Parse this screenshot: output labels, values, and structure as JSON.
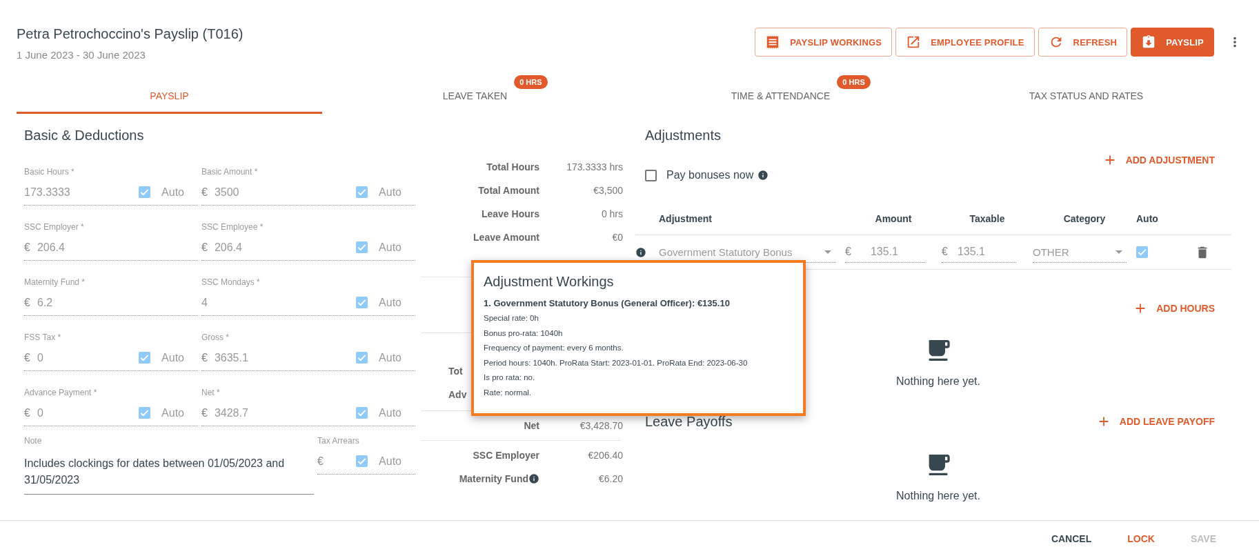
{
  "header": {
    "title": "Petra Petrochoccino's Payslip (T016)",
    "period": "1 June 2023 - 30 June 2023",
    "actions": [
      {
        "label": "PAYSLIP WORKINGS",
        "kind": "outlined"
      },
      {
        "label": "EMPLOYEE PROFILE",
        "kind": "outlined"
      },
      {
        "label": "REFRESH",
        "kind": "outlined"
      },
      {
        "label": "PAYSLIP",
        "kind": "filled"
      }
    ]
  },
  "tabs": [
    {
      "label": "PAYSLIP",
      "selected": true
    },
    {
      "label": "LEAVE TAKEN",
      "selected": false,
      "badge": "0 HRS"
    },
    {
      "label": "TIME & ATTENDANCE",
      "selected": false,
      "badge": "0 HRS"
    },
    {
      "label": "TAX STATUS AND RATES",
      "selected": false
    }
  ],
  "basic": {
    "title": "Basic & Deductions",
    "fields": [
      {
        "label": "Basic Hours *",
        "value": "173.3333",
        "kind": "auto",
        "checked": true,
        "auto_label": "Auto"
      },
      {
        "label": "Basic Amount *",
        "prefix": "€",
        "value": "3500",
        "kind": "auto",
        "checked": true,
        "auto_label": "Auto"
      },
      {
        "label": "SSC Employer *",
        "prefix": "€",
        "value": "206.4",
        "kind": "plain"
      },
      {
        "label": "SSC Employee *",
        "prefix": "€",
        "value": "206.4",
        "kind": "auto",
        "checked": true,
        "auto_label": "Auto"
      },
      {
        "label": "Maternity Fund *",
        "prefix": "€",
        "value": "6.2",
        "kind": "plain"
      },
      {
        "label": "SSC Mondays *",
        "value": "4",
        "kind": "auto",
        "checked": true,
        "auto_label": "Auto"
      },
      {
        "label": "FSS Tax *",
        "prefix": "€",
        "value": "0",
        "kind": "auto",
        "checked": true,
        "auto_label": "Auto"
      },
      {
        "label": "Gross *",
        "prefix": "€",
        "value": "3635.1",
        "kind": "auto",
        "checked": true,
        "auto_label": "Auto"
      },
      {
        "label": "Advance Payment *",
        "prefix": "€",
        "value": "0",
        "kind": "auto",
        "checked": true,
        "auto_label": "Auto"
      },
      {
        "label": "Net *",
        "prefix": "€",
        "value": "3428.7",
        "kind": "auto",
        "checked": true,
        "auto_label": "Auto"
      }
    ],
    "note": {
      "label": "Note",
      "value": "Includes clockings for dates between 01/05/2023 and 31/05/2023"
    },
    "tax_arrears": {
      "label": "Tax Arrears",
      "prefix": "€",
      "auto_label": "Auto",
      "checked": true
    }
  },
  "summary": {
    "groups": [
      [
        {
          "label": "Total Hours",
          "value": "173.3333 hrs"
        },
        {
          "label": "Total Amount",
          "value": "€3,500"
        },
        {
          "label": "Leave Hours",
          "value": "0 hrs"
        },
        {
          "label": "Leave Amount",
          "value": "€0"
        }
      ],
      [
        {
          "label": "Tot",
          "kind": "cut"
        },
        {
          "label": "Adv",
          "kind": "cut"
        }
      ],
      [
        {
          "label": "Net",
          "value": "€3,428.70"
        }
      ],
      [
        {
          "label": "SSC Employer",
          "value": "€206.40"
        },
        {
          "label": "Maternity Fund",
          "value": "€6.20",
          "info": true
        }
      ]
    ]
  },
  "adjustments": {
    "title": "Adjustments",
    "add_label": "ADD ADJUSTMENT",
    "pay_bonuses": {
      "label": "Pay bonuses now",
      "checked": false
    },
    "columns": [
      "Adjustment",
      "Amount",
      "Taxable",
      "Category",
      "Auto"
    ],
    "rows": [
      {
        "adjustment": "Government Statutory Bonus",
        "amount_prefix": "€",
        "amount": "135.1",
        "taxable_prefix": "€",
        "taxable": "135.1",
        "category": "OTHER",
        "auto": true
      }
    ]
  },
  "hours": {
    "add_label": "ADD HOURS",
    "empty": "Nothing here yet."
  },
  "leave_payoffs": {
    "title": "Leave Payoffs",
    "add_label": "ADD LEAVE PAYOFF",
    "empty": "Nothing here yet."
  },
  "popup": {
    "title": "Adjustment Workings",
    "heading": "1. Government Statutory Bonus (General Officer): €135.10",
    "lines": [
      "Special rate: 0h",
      "Bonus pro-rata: 1040h",
      "Frequency of payment: every 6 months.",
      "Period hours: 1040h. ProRata Start: 2023-01-01. ProRata End: 2023-06-30",
      "Is pro rata: no.",
      "Rate: normal."
    ]
  },
  "footer": {
    "buttons": [
      {
        "label": "CANCEL",
        "kind": "neutral",
        "disabled": false
      },
      {
        "label": "LOCK",
        "kind": "primary",
        "disabled": false
      },
      {
        "label": "SAVE",
        "kind": "primary",
        "disabled": true
      }
    ]
  }
}
